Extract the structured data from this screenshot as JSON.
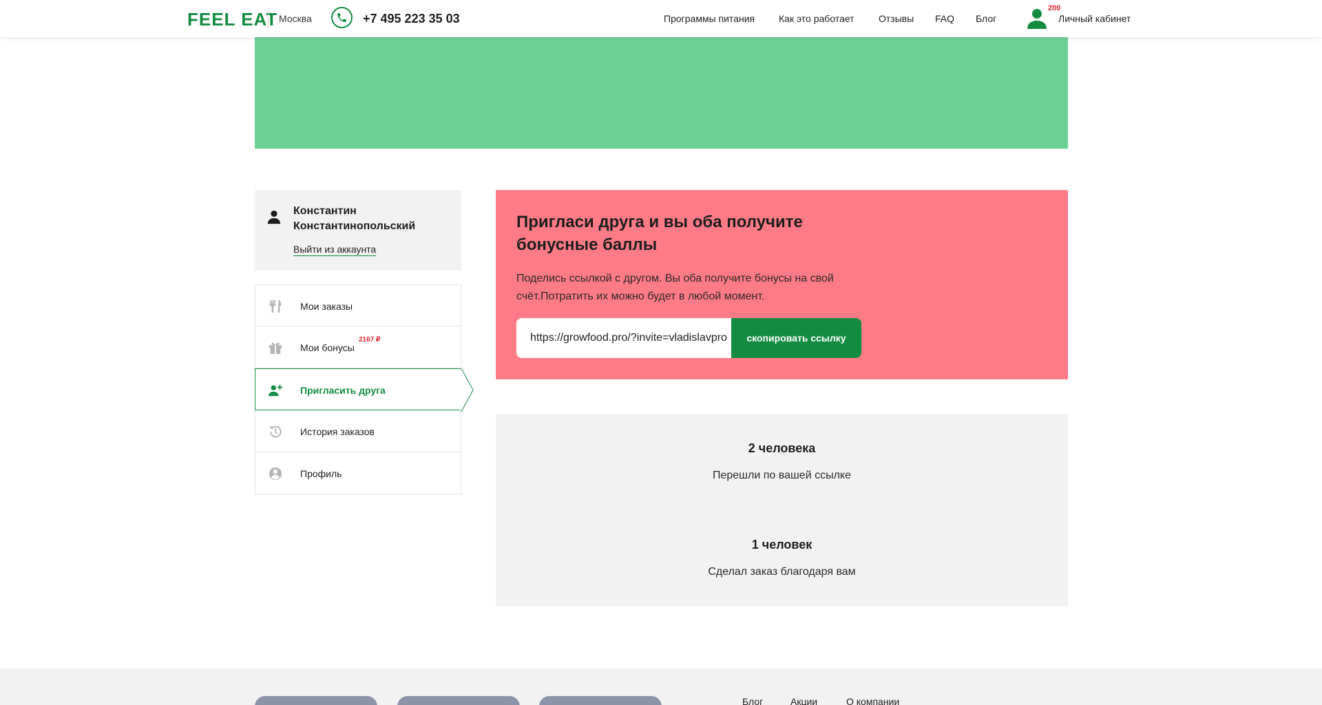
{
  "header": {
    "logo": "FEEL EAT",
    "city": "Москва",
    "phone": "+7 495 223 35 03",
    "nav": [
      "Программы питания",
      "Как это работает",
      "Отзывы",
      "FAQ",
      "Блог"
    ],
    "cabinet_badge": "200",
    "cabinet_label": "Личный кабинет"
  },
  "sidebar": {
    "user_name": "Константин Константинопольский",
    "logout": "Выйти из аккаунта",
    "menu": [
      {
        "label": "Мои заказы",
        "icon": "cutlery-icon"
      },
      {
        "label": "Мои бонусы",
        "icon": "gift-icon",
        "badge": "2167 ₽"
      },
      {
        "label": "Пригласить друга",
        "icon": "add-user-icon",
        "active": true
      },
      {
        "label": "История заказов",
        "icon": "history-icon"
      },
      {
        "label": "Профиль",
        "icon": "profile-icon"
      }
    ]
  },
  "invite": {
    "title": "Пригласи друга и вы оба получите бонусные баллы",
    "text": "Поделись ссылкой с другом. Вы оба получите бонусы на свой счёт.Потратить их можно будет в любой момент.",
    "link_value": "https://growfood.pro/?invite=vladislavpro",
    "copy_button": "скопировать ссылку"
  },
  "stats": [
    {
      "value": "2 человека",
      "label": "Перешли по вашей ссылке"
    },
    {
      "value": "1 человек",
      "label": "Сделал заказ благодаря вам"
    }
  ],
  "footer": {
    "links": [
      "Блог",
      "Акции",
      "О компании"
    ]
  },
  "colors": {
    "brand_green": "#138c42",
    "banner_green": "#6dd094",
    "invite_pink": "#ff7b87",
    "badge_red": "#e0262f"
  }
}
